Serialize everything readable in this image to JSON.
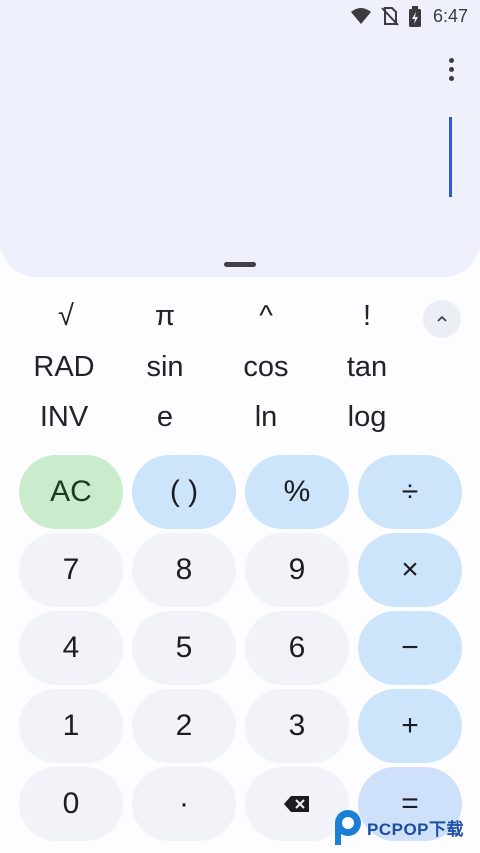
{
  "status": {
    "time": "6:47",
    "icons": [
      "wifi-icon",
      "no-sim-icon",
      "battery-charging-icon"
    ]
  },
  "display": {
    "expression": "",
    "menu_icon": "more-vert-icon"
  },
  "scientific": {
    "row1": [
      "√",
      "π",
      "^",
      "!"
    ],
    "row2": [
      "RAD",
      "sin",
      "cos",
      "tan"
    ],
    "row3": [
      "INV",
      "e",
      "ln",
      "log"
    ],
    "collapse_icon": "chevron-up-icon"
  },
  "keypad": {
    "ac": "AC",
    "parens": "( )",
    "percent": "%",
    "divide": "÷",
    "seven": "7",
    "eight": "8",
    "nine": "9",
    "multiply": "×",
    "four": "4",
    "five": "5",
    "six": "6",
    "minus": "−",
    "one": "1",
    "two": "2",
    "three": "3",
    "plus": "+",
    "zero": "0",
    "decimal": "·",
    "backspace_icon": "backspace-icon",
    "equals": "="
  },
  "watermark": {
    "text": "PCPOP下载"
  },
  "colors": {
    "display_bg": "#eef1fb",
    "operator_key": "#cde5fb",
    "ac_key": "#c9eccd",
    "number_key": "#f1f3f9",
    "cursor": "#2e5bd2"
  }
}
